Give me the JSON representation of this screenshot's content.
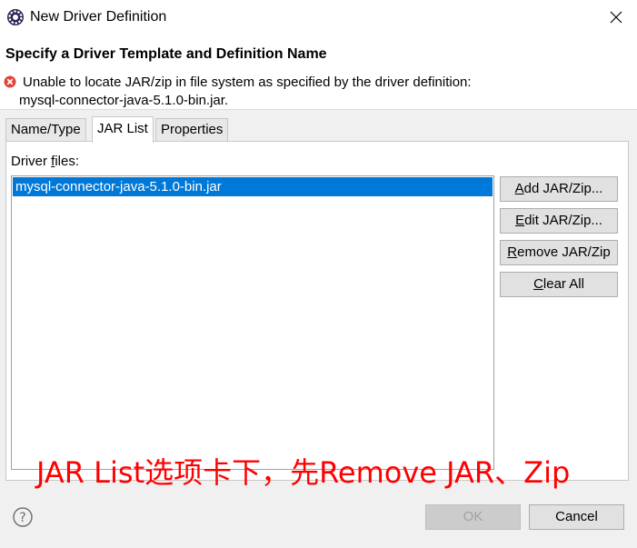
{
  "window": {
    "title": "New Driver Definition",
    "app_icon": "eclipse-gear-icon",
    "close_icon": "close-icon"
  },
  "header": {
    "title": "Specify a Driver Template and Definition Name",
    "error_icon": "error-icon",
    "error_color": "#e0443e",
    "error_line1": "Unable to locate JAR/zip in file system as specified by the driver definition:",
    "error_line2": "mysql-connector-java-5.1.0-bin.jar."
  },
  "tabs": [
    {
      "label": "Name/Type",
      "active": false
    },
    {
      "label": "JAR List",
      "active": true
    },
    {
      "label": "Properties",
      "active": false
    }
  ],
  "jar_panel": {
    "label_pre": "Driver ",
    "label_underlined": "f",
    "label_post": "iles:",
    "files": [
      "mysql-connector-java-5.1.0-bin.jar"
    ],
    "selected_color": "#0078d7",
    "buttons": {
      "add": {
        "mnemonic": "A",
        "rest": "dd JAR/Zip..."
      },
      "edit": {
        "mnemonic": "E",
        "rest": "dit JAR/Zip..."
      },
      "remove": {
        "mnemonic": "R",
        "rest": "emove JAR/Zip"
      },
      "clear": {
        "mnemonic": "C",
        "rest": "lear All"
      }
    }
  },
  "annotation": {
    "text": "JAR List选项卡下，先Remove JAR、Zip",
    "color": "#ff0000"
  },
  "footer": {
    "help_icon": "help-icon",
    "ok_label": "OK",
    "ok_enabled": false,
    "cancel_label": "Cancel"
  }
}
